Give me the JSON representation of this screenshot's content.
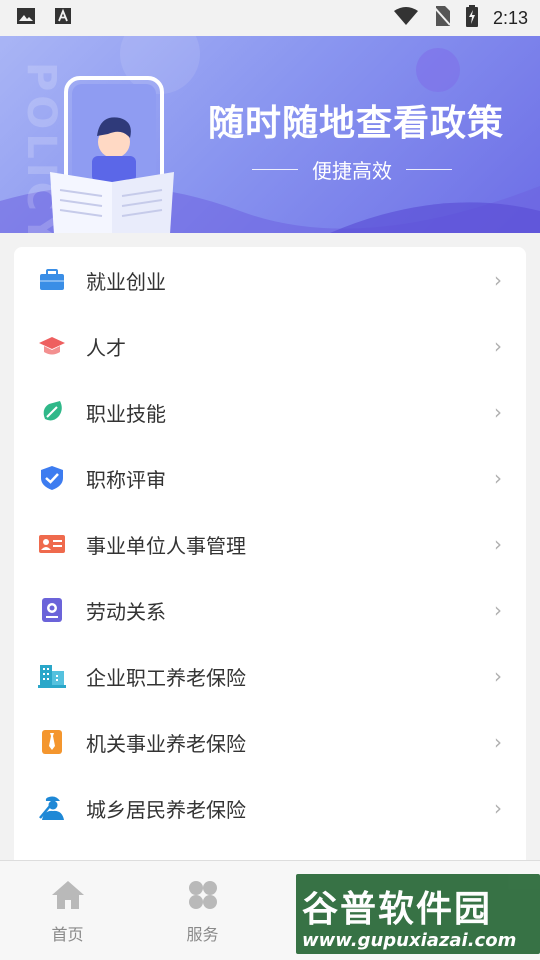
{
  "status_bar": {
    "time": "2:13"
  },
  "banner": {
    "title": "随时随地查看政策",
    "subtitle": "便捷高效",
    "bg_text": "POLICY"
  },
  "policy_list": {
    "items": [
      {
        "label": "就业创业",
        "icon": "briefcase-icon",
        "color": "#3a8ee6"
      },
      {
        "label": "人才",
        "icon": "graduation-cap-icon",
        "color": "#ee5f5f"
      },
      {
        "label": "职业技能",
        "icon": "tag-icon",
        "color": "#2fb889"
      },
      {
        "label": "职称评审",
        "icon": "shield-check-icon",
        "color": "#3d7cf0"
      },
      {
        "label": "事业单位人事管理",
        "icon": "id-card-icon",
        "color": "#ef6a4d"
      },
      {
        "label": "劳动关系",
        "icon": "document-badge-icon",
        "color": "#6b63d9"
      },
      {
        "label": "企业职工养老保险",
        "icon": "building-icon",
        "color": "#2aa7c9"
      },
      {
        "label": "机关事业养老保险",
        "icon": "necktie-icon",
        "color": "#f4962e"
      },
      {
        "label": "城乡居民养老保险",
        "icon": "worker-icon",
        "color": "#1e88d6"
      }
    ],
    "chevron": "›"
  },
  "bottom_nav": {
    "items": [
      {
        "label": "首页",
        "icon": "home-icon"
      },
      {
        "label": "服务",
        "icon": "grid-icon"
      }
    ]
  },
  "watermark": {
    "title": "谷普软件园",
    "url": "www.gupuxiazai.com"
  }
}
